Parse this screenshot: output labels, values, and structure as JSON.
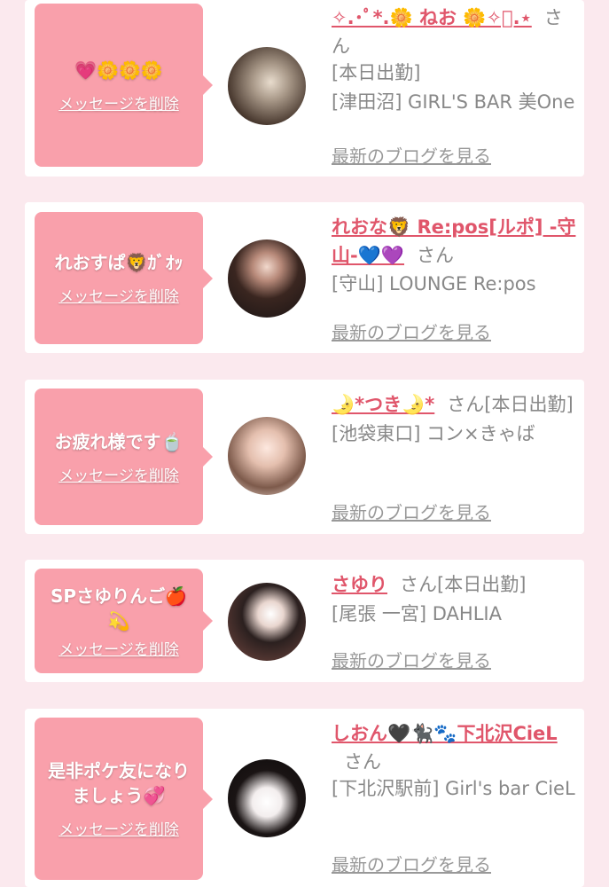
{
  "delete_label": "メッセージを削除",
  "san_label": "さん",
  "blog_label": "最新のブログを見る",
  "colors": {
    "background": "#fbe9ee",
    "bubble": "#f9a0ab",
    "name": "#e0566b",
    "muted": "#888888"
  },
  "cards": [
    {
      "message": "💗🌼🌼🌼",
      "name": "✧.･ﾟ*.🌼 ねお 🌼✧ﾟ.⋆",
      "details": [
        "[本日出勤]",
        "[津田沼] GIRL'S BAR 美One"
      ]
    },
    {
      "message": "れおすぱ🦁ｶﾞｵｯ",
      "name": "れおな🦁 Re:pos[ルポ] -守山-💙💜",
      "details": [
        "[守山] LOUNGE Re:pos"
      ]
    },
    {
      "message": "お疲れ様です🍵",
      "name": "🌛*つき🌛*",
      "details": [
        "[本日出勤]",
        "[池袋東口] コン×きゃば"
      ]
    },
    {
      "message": "SPさゆりんご🍎💫",
      "name": "さゆり",
      "details": [
        "[本日出勤]",
        "[尾張 一宮] DAHLIA"
      ]
    },
    {
      "message": "是非ポケ友になりましょう💞",
      "name": "しおん🖤🐈‍⬛🐾下北沢CieL",
      "details": [
        "[下北沢駅前] Girl's bar CieL"
      ]
    }
  ]
}
